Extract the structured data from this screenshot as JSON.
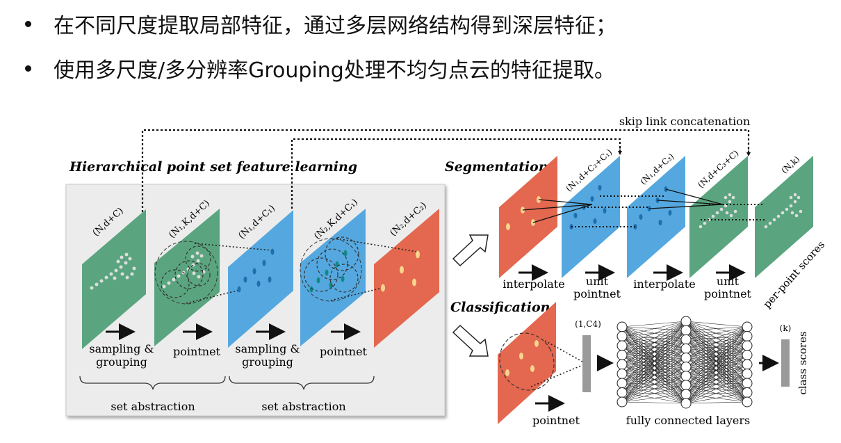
{
  "bullets": [
    "在不同尺度提取局部特征，通过多层网络结构得到深层特征；",
    "使用多尺度/多分辨率Grouping处理不均匀点云的特征提取。"
  ],
  "diagram": {
    "skip_link": "skip link concatenation",
    "hier_title": "Hierarchical point set feature learning",
    "seg_title": "Segmentation",
    "cls_title": "Classification",
    "hier_layers": [
      "(N,d+C)",
      "(N₁,K,d+C)",
      "(N₁,d+C₁)",
      "(N₂,K,d+C₁)",
      "(N₂,d+C₂)"
    ],
    "sampling_line1": "sampling &",
    "sampling_line2": "grouping",
    "pointnet": "pointnet",
    "set_abstraction": "set abstraction",
    "seg_layers": [
      "(N₁,d+C₂+C₁)",
      "(N₁,d+C₃)",
      "(N,d+C₃+C)",
      "(N,k)"
    ],
    "interpolate": "interpolate",
    "unit": "unit",
    "per_point_scores": "per-point scores",
    "cls_vec1": "(1,C4)",
    "cls_vec2": "(k)",
    "fc_layers": "fully connected layers",
    "class_scores": "class scores"
  }
}
